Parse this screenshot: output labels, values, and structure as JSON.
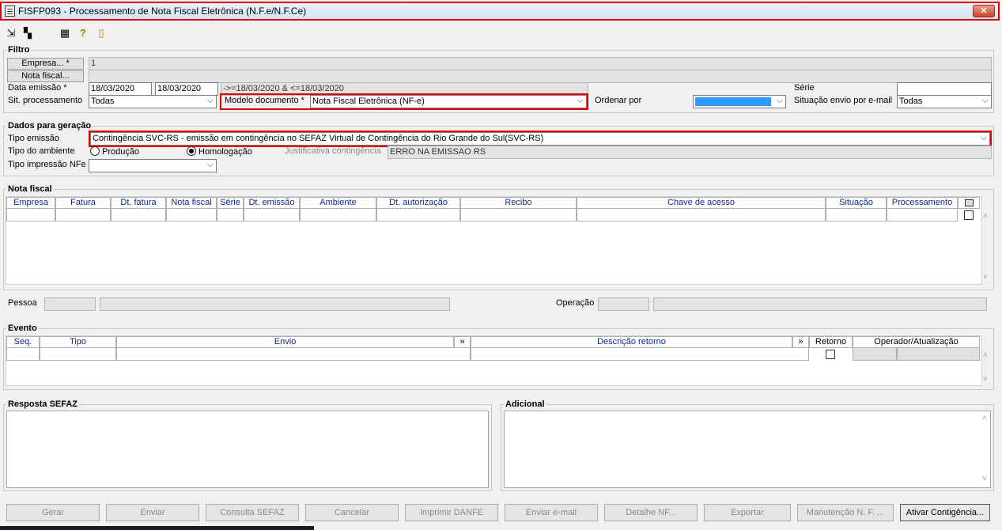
{
  "window": {
    "title": "FISFP093 - Processamento de Nota Fiscal Eletrônica (N.F.e/N.F.Ce)",
    "close_label": "✕"
  },
  "filtro": {
    "group_label": "Filtro",
    "empresa_button": "Empresa... *",
    "empresa_value": "1",
    "nota_fiscal_button": "Nota fiscal...",
    "data_emissao_label": "Data emissão *",
    "data_inicio": "18/03/2020",
    "data_fim": "18/03/2020",
    "data_expr": "->=18/03/2020 & <=18/03/2020",
    "serie_label": "Série",
    "sit_processamento_label": "Sit. processamento",
    "sit_processamento_value": "Todas",
    "modelo_documento_label": "Modelo documento *",
    "modelo_documento_value": "Nota Fiscal Eletrônica (NF-e)",
    "ordenar_por_label": "Ordenar por",
    "situacao_envio_label": "Situação envio por e-mail",
    "situacao_envio_value": "Todas"
  },
  "dados": {
    "group_label": "Dados para geração",
    "tipo_emissao_label": "Tipo emissão",
    "tipo_emissao_value": "Contingência SVC-RS - emissão em contingência no SEFAZ Virtual de Contingência do Rio Grande do Sul(SVC-RS)",
    "tipo_ambiente_label": "Tipo do ambiente",
    "producao_label": "Produção",
    "homologacao_label": "Homologação",
    "justificativa_label": "Justificativa contingência",
    "justificativa_value": "ERRO NA EMISSAO RS",
    "tipo_impressao_label": "Tipo impressão NFe"
  },
  "nota_fiscal": {
    "group_label": "Nota fiscal",
    "columns": [
      "Empresa",
      "Fatura",
      "Dt. fatura",
      "Nota fiscal",
      "Série",
      "Dt. emissão",
      "Ambiente",
      "Dt. autorização",
      "Recibo",
      "Chave de acesso",
      "Situação",
      "Processamento"
    ]
  },
  "pessoa_label": "Pessoa",
  "operacao_label": "Operação",
  "evento": {
    "group_label": "Evento",
    "columns": [
      "Seq.",
      "Tipo",
      "Envio",
      "»",
      "Descrição retorno",
      "»",
      "Retorno",
      "Operador/Atualização"
    ]
  },
  "resposta_sefaz_label": "Resposta SEFAZ",
  "adicional_label": "Adicional",
  "buttons": [
    "Gerar",
    "Enviar",
    "Consulta SEFAZ",
    "Cancelar",
    "Imprimir DANFE",
    "Enviar e-mail",
    "Detalhe NF...",
    "Exportar",
    "Manutenção N. F. ...",
    "Ativar Contigência..."
  ],
  "colors": {
    "highlight": "#e00000",
    "header_text": "#0a2a8a",
    "selection": "#3399ff"
  },
  "toolbar_icons": [
    "exit-icon",
    "windows-icon",
    "calculator-icon",
    "help-icon",
    "door-icon"
  ]
}
